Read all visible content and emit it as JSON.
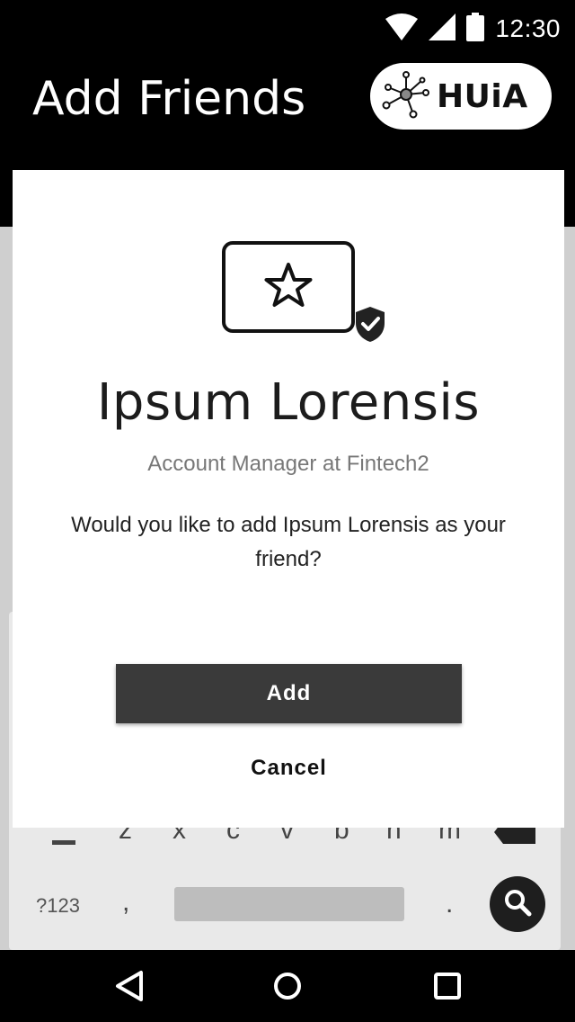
{
  "status_bar": {
    "time": "12:30",
    "icons": [
      "wifi-icon",
      "signal-icon",
      "battery-icon"
    ]
  },
  "app_bar": {
    "title": "Add Friends",
    "logo_text": "HUiA",
    "logo_icon": "network-hub-icon"
  },
  "dialog": {
    "icon": "starred-card-icon",
    "badge_icon": "verified-shield-icon",
    "name": "Ipsum Lorensis",
    "subtitle": "Account Manager at Fintech2",
    "question_line1": "Would you like to add Ipsum Lorensis as your",
    "question_line2": "friend?",
    "add_label": "Add",
    "cancel_label": "Cancel"
  },
  "keyboard": {
    "row3_keys": [
      "z",
      "x",
      "c",
      "v",
      "b",
      "n",
      "m"
    ],
    "symbols_key": "?123",
    "comma_key": ",",
    "period_key": ".",
    "search_icon": "search-icon"
  },
  "nav_bar": {
    "icons": [
      "back-icon",
      "home-icon",
      "recents-icon"
    ]
  },
  "colors": {
    "bar_background": "#000000",
    "dialog_background": "#ffffff",
    "primary_button": "#3a3a3a",
    "subtitle_text": "#777777"
  }
}
